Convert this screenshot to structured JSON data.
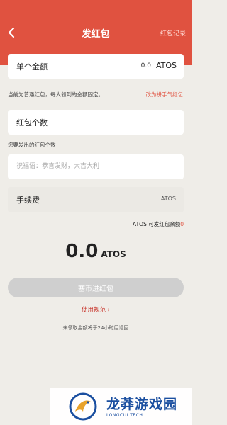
{
  "header": {
    "title": "发红包",
    "records_label": "红包记录"
  },
  "amount_card": {
    "label": "单个金额",
    "value": "0.0",
    "unit": "ATOS"
  },
  "hints": {
    "normal_packet": "当前为普通红包，每人领到的金额固定。",
    "switch_mode": "改为拼手气红包",
    "count_hint": "您要发出的红包个数"
  },
  "count_card": {
    "label": "红包个数"
  },
  "greeting_card": {
    "placeholder": "祝福语：恭喜发财，大吉大利"
  },
  "fee_card": {
    "label": "手续费",
    "value": "ATOS"
  },
  "balance": {
    "text": "ATOS 可发红包余额",
    "value": "0"
  },
  "total": {
    "amount": "0.0",
    "unit": "ATOS"
  },
  "actions": {
    "submit_label": "塞币进红包",
    "usage_label": "使用规范 ›",
    "refund_note": "未领取金额将于24小时后退回"
  },
  "watermark": {
    "name": "龙莽游戏园",
    "sub": "LONGCUI TECH"
  },
  "colors": {
    "brand_red": "#e05240",
    "background": "#efede8",
    "watermark_blue": "#1b4fa0"
  }
}
